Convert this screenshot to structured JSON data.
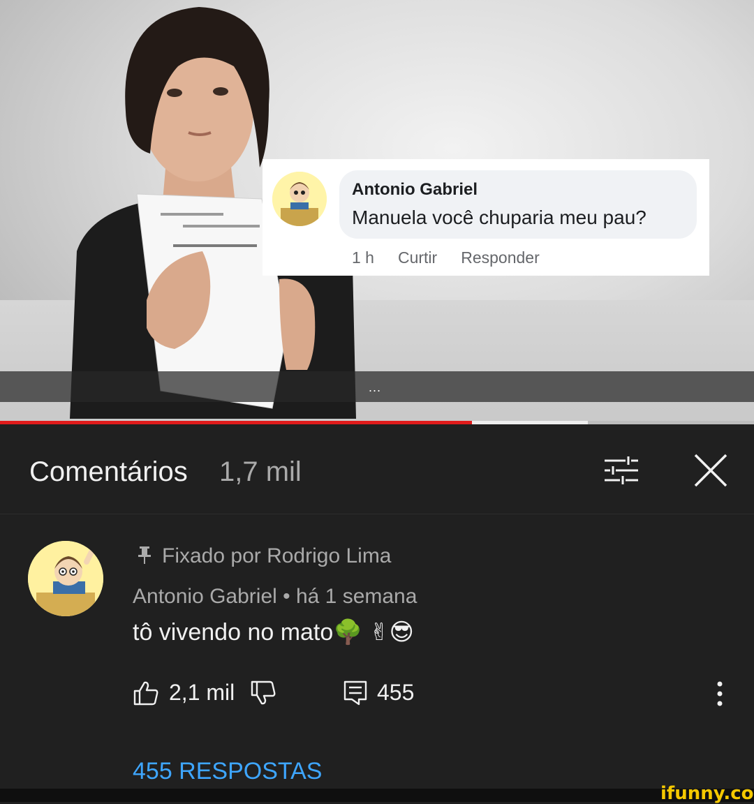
{
  "video": {
    "fb_comment": {
      "author": "Antonio Gabriel",
      "text": "Manuela você chuparia meu pau?",
      "time": "1 h",
      "like_label": "Curtir",
      "reply_label": "Responder"
    },
    "more_label": "...",
    "progress_fraction": 0.626,
    "colors": {
      "progress": "#e01b1b"
    }
  },
  "comments_panel": {
    "title": "Comentários",
    "count": "1,7 mil",
    "icons": [
      "filter-icon",
      "close-icon"
    ]
  },
  "comment": {
    "pinned_label": "Fixado por Rodrigo Lima",
    "author_line": "Antonio Gabriel • há 1 semana",
    "text": "tô vivendo no mato🌳 ✌😎",
    "likes": "2,1 mil",
    "replies": "455",
    "icons": [
      "pin-icon",
      "like-icon",
      "dislike-icon",
      "reply-icon",
      "more-vert-icon"
    ]
  },
  "replies_link": "455 RESPOSTAS",
  "watermark": "ifunny.co",
  "colors": {
    "link": "#3ea6ff",
    "background": "#202020"
  }
}
